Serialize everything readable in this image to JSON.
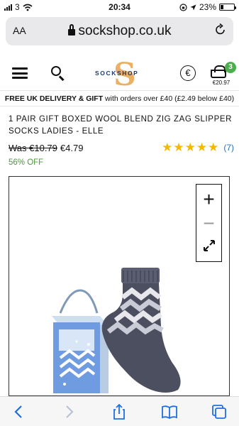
{
  "status": {
    "carrier": "3",
    "time": "20:34",
    "battery": "23%",
    "battery_level": 0.23
  },
  "urlbar": {
    "aa_label": "AA",
    "url": "sockshop.co.uk"
  },
  "header": {
    "logo_text": "SOCKSHOP",
    "currency_symbol": "€",
    "basket_count": "3",
    "basket_total": "€20.97"
  },
  "delivery": {
    "bold": "FREE UK DELIVERY & GIFT",
    "rest": " with orders over £40 (£2.49 below £40)"
  },
  "product": {
    "title": "1 PAIR GIFT BOXED WOOL BLEND ZIG ZAG SLIPPER SOCKS LADIES - ELLE",
    "was_price": "Was €10.79",
    "price": "€4.79",
    "discount": "56% OFF",
    "rating_stars": 5,
    "review_count": "(7)"
  },
  "zoom_controls": {
    "zoom_in": "+",
    "zoom_out": "−"
  },
  "colors": {
    "accent_green": "#4cae4c",
    "star": "#f5b800",
    "link_blue": "#2a6fb0",
    "discount_green": "#4a9b3a",
    "logo_orange": "#e8a34a",
    "logo_navy": "#1d3a6b",
    "safari_blue": "#1f6fe3"
  },
  "icons": {
    "menu": "hamburger-icon",
    "search": "search-icon",
    "currency": "euro-icon",
    "basket": "basket-icon",
    "lock": "lock-icon",
    "reload": "reload-icon",
    "fullscreen": "fullscreen-icon"
  }
}
